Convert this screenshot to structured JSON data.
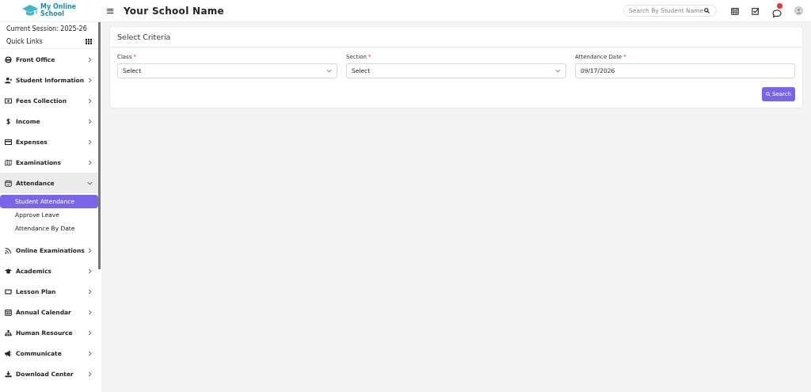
{
  "header": {
    "logo_text": [
      "My Online",
      "School"
    ],
    "menu_glyph": "≡",
    "title": "Your School Name",
    "search": {
      "placeholder": "Search By Student Name"
    }
  },
  "sidebar": {
    "session": "Current Session: 2025-26",
    "quick_links": "Quick Links",
    "items": [
      {
        "label": "Front Office",
        "expanded": false
      },
      {
        "label": "Student Information",
        "expanded": false
      },
      {
        "label": "Fees Collection",
        "expanded": false
      },
      {
        "label": "Income",
        "expanded": false
      },
      {
        "label": "Expenses",
        "expanded": false
      },
      {
        "label": "Examinations",
        "expanded": false
      },
      {
        "label": "Attendance",
        "expanded": true,
        "children": [
          {
            "label": "Student Attendance",
            "selected": true
          },
          {
            "label": "Approve Leave",
            "selected": false
          },
          {
            "label": "Attendance By Date",
            "selected": false
          }
        ]
      },
      {
        "label": "Online Examinations",
        "expanded": false
      },
      {
        "label": "Academics",
        "expanded": false
      },
      {
        "label": "Lesson Plan",
        "expanded": false
      },
      {
        "label": "Annual Calendar",
        "expanded": false
      },
      {
        "label": "Human Resource",
        "expanded": false
      },
      {
        "label": "Communicate",
        "expanded": false
      },
      {
        "label": "Download Center",
        "expanded": false
      }
    ]
  },
  "criteria": {
    "title": "Select Criteria",
    "fields": [
      {
        "kind": "select",
        "label": "Class",
        "required_mark": "*",
        "value": "Select"
      },
      {
        "kind": "select",
        "label": "Section",
        "required_mark": "*",
        "value": "Select"
      },
      {
        "kind": "date",
        "label": "Attendance Date",
        "required_mark": "*",
        "value": "09/17/2026"
      }
    ],
    "button": "Search"
  }
}
